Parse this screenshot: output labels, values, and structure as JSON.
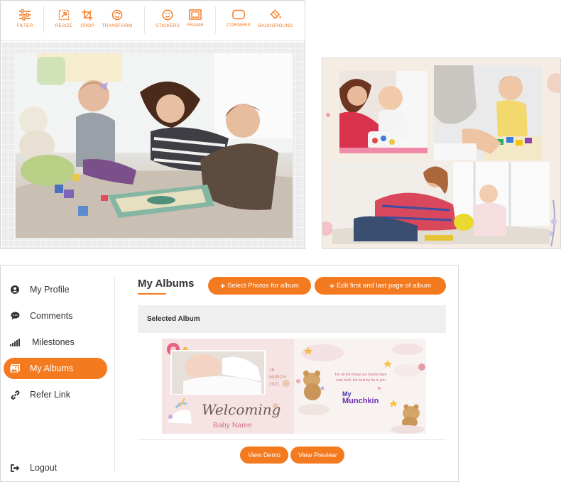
{
  "toolbar": {
    "tools": [
      {
        "label": "FILTER",
        "icon": "sliders-icon"
      },
      {
        "label": "RESIZE",
        "icon": "resize-icon"
      },
      {
        "label": "CROP",
        "icon": "crop-icon"
      },
      {
        "label": "TRANSFORM",
        "icon": "rotate-icon"
      },
      {
        "label": "STICKERS",
        "icon": "smiley-icon"
      },
      {
        "label": "FRAME",
        "icon": "frame-icon"
      },
      {
        "label": "CORNERS",
        "icon": "rounded-corners-icon"
      },
      {
        "label": "BACKGROUND",
        "icon": "paint-bucket-icon"
      }
    ]
  },
  "sidebar": {
    "items": [
      {
        "label": "My Profile",
        "icon": "user-icon"
      },
      {
        "label": "Comments",
        "icon": "comment-icon"
      },
      {
        "label": "Milestones",
        "icon": "signal-bars-icon"
      },
      {
        "label": "My Albums",
        "icon": "album-icon",
        "active": true
      },
      {
        "label": "Refer Link",
        "icon": "link-icon"
      }
    ],
    "logout": {
      "label": "Logout",
      "icon": "logout-icon"
    }
  },
  "albums": {
    "title": "My Albums",
    "select_button": "Select Photos for album",
    "edit_button": "Edit first and last page of album",
    "selected_label": "Selected Album",
    "view_demo": "View Demo",
    "view_preview": "View Preview",
    "cover": {
      "date_day": "26",
      "date_month": "MARCH",
      "date_year": "2021",
      "welcome_text": "Welcoming",
      "baby_name": "Baby Name",
      "quote": "For all the things our hands have ever held, the best by far is you",
      "logo_line1": "My",
      "logo_line2": "Munchkin"
    }
  },
  "colors": {
    "accent": "#f47a20",
    "panel_bg": "#efefef",
    "collage_bg": "#f5ece4"
  }
}
